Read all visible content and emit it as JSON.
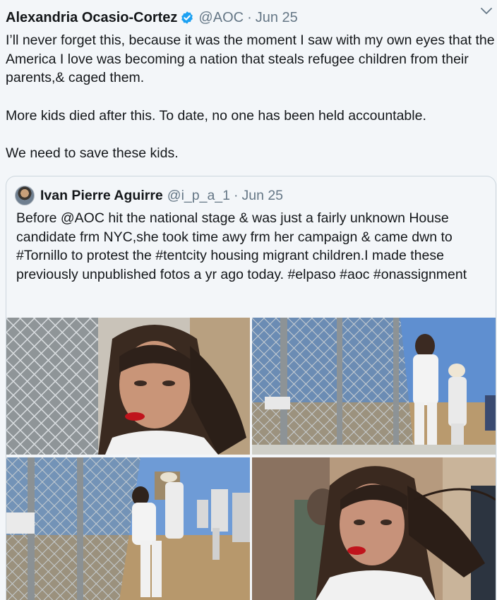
{
  "tweet": {
    "author_name": "Alexandria Ocasio-Cortez",
    "handle": "@AOC",
    "separator": "·",
    "date": "Jun 25",
    "paragraphs": [
      "I’ll never forget this, because it was the moment I saw with my own eyes that the America I love was becoming a nation that steals refugee children from their parents,& caged them.",
      "More kids died after this. To date, no one has been held accountable.",
      "We need to save these kids."
    ],
    "icons": {
      "verified": "verified-badge-icon",
      "menu": "chevron-down-icon"
    },
    "colors": {
      "verified": "#1da1f2",
      "meta": "#657786",
      "text": "#14171a",
      "border": "#ccd6dd"
    }
  },
  "quoted_tweet": {
    "author_name": "Ivan Pierre Aguirre",
    "handle": "@i_p_a_1",
    "separator": "·",
    "date": "Jun 25",
    "text": "Before @AOC hit the national stage & was just a fairly unknown House candidate frm NYC,she took time awy frm her campaign & came dwn to #Tornillo to protest the #tentcity housing migrant children.I made these previously unpublished fotos a yr ago today. #elpaso #aoc #onassignment",
    "photo_count": 4
  }
}
